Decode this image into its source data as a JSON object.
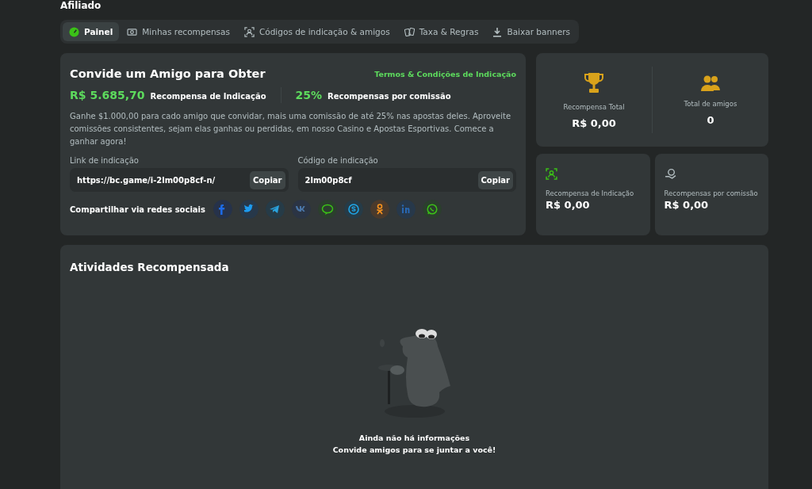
{
  "page_title": "Afiliado",
  "tabs": [
    {
      "label": "Painel",
      "kind": "gauge",
      "selected": true
    },
    {
      "label": "Minhas recompensas",
      "kind": "cash",
      "selected": false
    },
    {
      "label": "Códigos de indicação & amigos",
      "kind": "target",
      "selected": false
    },
    {
      "label": "Taxa & Regras",
      "kind": "cards",
      "selected": false
    },
    {
      "label": "Baixar banners",
      "kind": "download",
      "selected": false
    }
  ],
  "invite": {
    "title": "Convide um Amigo para Obter",
    "terms_link": "Termos & Condições de Indicação",
    "highlights": [
      {
        "value": "R$ 5.685,70",
        "label": "Recompensa de Indicação"
      },
      {
        "value": "25%",
        "label": "Recompensas por comissão"
      }
    ],
    "description": "Ganhe $1.000,00 para cado amigo que convidar, mais uma comissão de até 25% nas apostas deles. Aproveite comissões consistentes, sejam elas ganhas ou perdidas, em nosso Casino e Apostas Esportivas. Comece a ganhar agora!",
    "fields": [
      {
        "label": "Link de indicação",
        "value": "https://bc.game/i-2lm00p8cf-n/",
        "button": "Copiar"
      },
      {
        "label": "Código de indicação",
        "value": "2lm00p8cf",
        "button": "Copiar"
      }
    ],
    "share_label": "Compartilhar via redes sociais",
    "share": [
      {
        "kind": "facebook"
      },
      {
        "kind": "twitter"
      },
      {
        "kind": "telegram"
      },
      {
        "kind": "vk"
      },
      {
        "kind": "line"
      },
      {
        "kind": "skype"
      },
      {
        "kind": "odnoklassniki"
      },
      {
        "kind": "linkedin"
      },
      {
        "kind": "whatsapp"
      }
    ]
  },
  "totals": [
    {
      "label": "Recompensa Total",
      "value": "R$ 0,00",
      "kind": "trophy"
    },
    {
      "label": "Total de amigos",
      "value": "0",
      "kind": "people"
    }
  ],
  "rewards": [
    {
      "label": "Recompensa de Indicação",
      "value": "R$ 0,00",
      "kind": "referral"
    },
    {
      "label": "Recompensas por comissão",
      "value": "R$ 0,00",
      "kind": "commission"
    }
  ],
  "activity": {
    "title": "Atividades Recompensada",
    "empty_title": "Ainda não há informações",
    "empty_text": "Convide amigos para se juntar a você!"
  }
}
